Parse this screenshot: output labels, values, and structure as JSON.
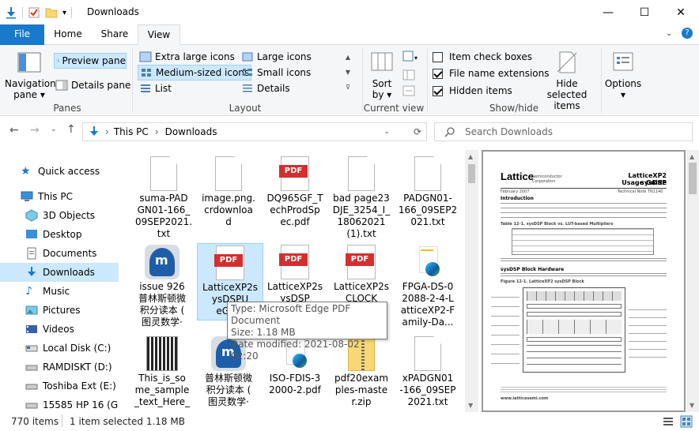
{
  "window": {
    "title": "Downloads",
    "controls": {
      "minimize": "—",
      "maximize": "☐",
      "close": "✕"
    }
  },
  "tabs": [
    {
      "label": "File"
    },
    {
      "label": "Home"
    },
    {
      "label": "Share"
    },
    {
      "label": "View"
    }
  ],
  "ribbon": {
    "panes": {
      "nav_line1": "Navigation",
      "nav_line2": "pane ▾",
      "preview": "Preview pane",
      "details": "Details pane",
      "group": "Panes"
    },
    "layout": {
      "xl": "Extra large icons",
      "large": "Large icons",
      "medium": "Medium-sized icons",
      "small": "Small icons",
      "list": "List",
      "details": "Details",
      "group": "Layout"
    },
    "current_view": {
      "sort_line1": "Sort",
      "sort_line2": "by ▾",
      "group": "Current view"
    },
    "show_hide": {
      "item_check": "Item check boxes",
      "file_ext": "File name extensions",
      "hidden": "Hidden items",
      "hide_sel_line1": "Hide selected",
      "hide_sel_line2": "items",
      "group": "Show/hide"
    },
    "options": {
      "label": "Options",
      "caret": "▾"
    }
  },
  "address": {
    "path": [
      "This PC",
      "Downloads"
    ],
    "search_placeholder": "Search Downloads"
  },
  "sidebar": [
    {
      "label": "Quick access",
      "icon": "star-icon"
    },
    {
      "label": "This PC",
      "icon": "computer-icon"
    },
    {
      "label": "3D Objects",
      "icon": "cube-icon"
    },
    {
      "label": "Desktop",
      "icon": "desktop-icon"
    },
    {
      "label": "Documents",
      "icon": "documents-icon"
    },
    {
      "label": "Downloads",
      "icon": "download-icon"
    },
    {
      "label": "Music",
      "icon": "music-icon"
    },
    {
      "label": "Pictures",
      "icon": "pictures-icon"
    },
    {
      "label": "Videos",
      "icon": "videos-icon"
    },
    {
      "label": "Local Disk (C:)",
      "icon": "drive-icon"
    },
    {
      "label": "RAMDISKT (D:)",
      "icon": "drive-icon"
    },
    {
      "label": "Toshiba Ext (E:)",
      "icon": "drive-icon"
    },
    {
      "label": "15585 HP 16 (G",
      "icon": "drive-icon"
    }
  ],
  "files": [
    {
      "name": "suma-PADGN01-166_09SEP2021.txt",
      "lines": [
        "suma-PAD",
        "GN01-166_",
        "09SEP2021.",
        "txt"
      ],
      "kind": "txt"
    },
    {
      "name": "image.png.crdownload",
      "lines": [
        "image.png.",
        "crdownloa",
        "d"
      ],
      "kind": "blank"
    },
    {
      "name": "DQ965GF_TechProdSpec.pdf",
      "lines": [
        "DQ965GF_T",
        "echProdSp",
        "ec.pdf"
      ],
      "kind": "pdf"
    },
    {
      "name": "bad page23DJE_3254_I_18062021 (1).txt",
      "lines": [
        "bad page23",
        "DJE_3254_I_",
        "18062021",
        "(1).txt"
      ],
      "kind": "txt"
    },
    {
      "name": "PADGN01-166_09SEP2021.txt",
      "lines": [
        "PADGN01-",
        "166_09SEP2",
        "021.txt"
      ],
      "kind": "txt"
    },
    {
      "name": "issue 926",
      "lines": [
        "issue 926",
        "普林斯顿微",
        "积分读本 (",
        "图灵数学·"
      ],
      "kind": "app"
    },
    {
      "name": "LatticeXP2sysDSPUsageGuide",
      "lines": [
        "LatticeXP2s",
        "ysDSPU",
        "eGuid"
      ],
      "kind": "pdf"
    },
    {
      "name": "LatticeXP2sysDSP",
      "lines": [
        "LatticeXP2s",
        "ysDSP"
      ],
      "kind": "pdf"
    },
    {
      "name": "LatticeXP2sCLOCK",
      "lines": [
        "LatticeXP2s",
        "CLOCK"
      ],
      "kind": "pdf"
    },
    {
      "name": "FPGA-DS-02088-2-4-LatticeXP2-Family-Da",
      "lines": [
        "FPGA-DS-0",
        "2088-2-4-L",
        "atticeXP2-F",
        "amily-Da..."
      ],
      "kind": "edge"
    },
    {
      "name": "This_is_some_sample_text_Here_",
      "lines": [
        "This_is_so",
        "me_sample",
        "_text_Here_"
      ],
      "kind": "qr"
    },
    {
      "name": "普林斯顿微积分读本",
      "lines": [
        "普林斯顿微",
        "积分读本 (",
        "图灵数学·"
      ],
      "kind": "app"
    },
    {
      "name": "ISO-FDIS-32000-2.pdf",
      "lines": [
        "ISO-FDIS-3",
        "2000-2.pdf"
      ],
      "kind": "edge"
    },
    {
      "name": "pdf20examples-master.zip",
      "lines": [
        "pdf20exam",
        "ples-maste",
        "r.zip"
      ],
      "kind": "zip"
    },
    {
      "name": "xPADGN01-166_09SEP2021.txt",
      "lines": [
        "xPADGN01",
        "-166_09SEP",
        "2021.txt"
      ],
      "kind": "txt"
    }
  ],
  "tooltip": {
    "type": "Type: Microsoft Edge PDF Document",
    "size": "Size: 1.18 MB",
    "modified": "Date modified: 2021-08-02 02:20"
  },
  "preview": {
    "logo": "Lattice",
    "logo_sub": "Semiconductor Corporation",
    "title": "LatticeXP2 sysDSP",
    "subtitle": "Usage Guide",
    "date": "February 2007",
    "note": "Technical Note TN1140",
    "h1": "Introduction",
    "h2": "sysDSP Block Hardware",
    "table_title": "Table 12-1. sysDSP Block vs. LUT-based Multipliers",
    "figure_title": "Figure 12-1. LatticeXP2 sysDSP Block",
    "footer": "www.latticesemi.com"
  },
  "status": {
    "count": "770 items",
    "selected": "1 item selected  1.18 MB"
  },
  "colors": {
    "accent": "#1979ca",
    "selection": "#cce8ff",
    "pdf_red": "#d42f2f"
  }
}
